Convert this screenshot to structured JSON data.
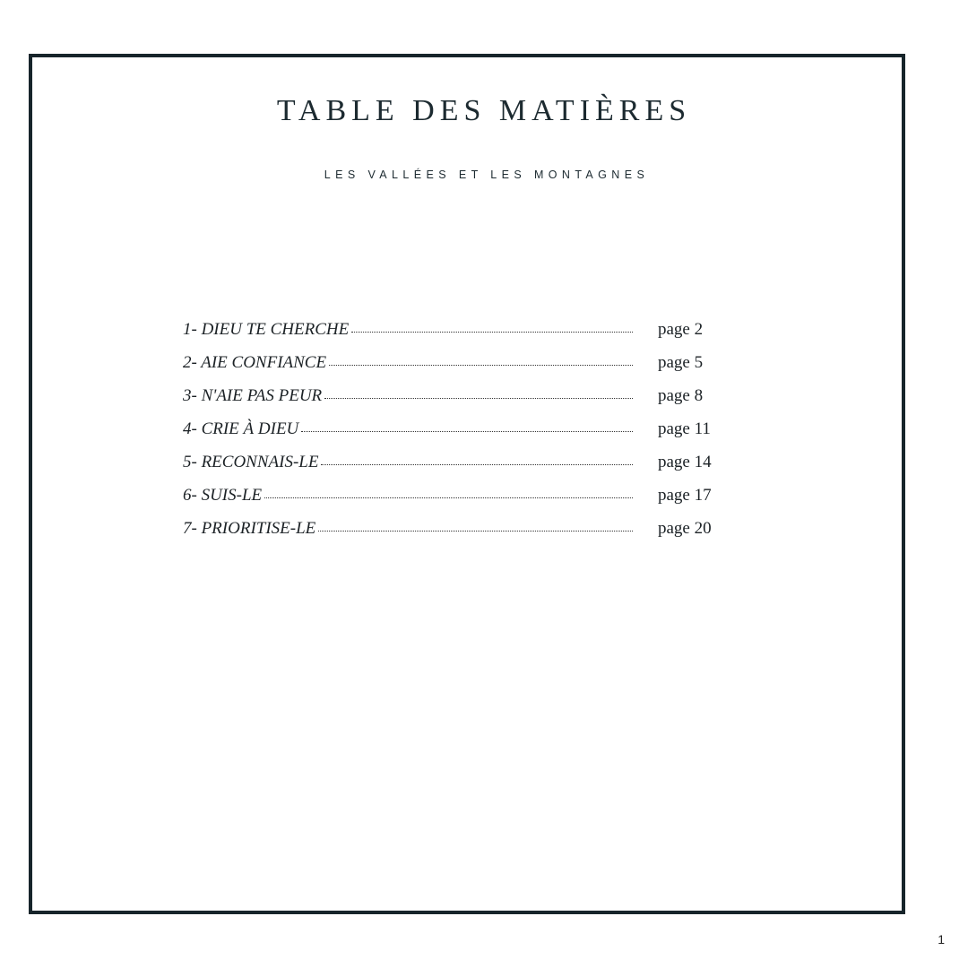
{
  "page": {
    "title": "TABLE DES MATIÈRES",
    "subtitle": "LES VALLÉES ET LES MONTAGNES",
    "page_number": "1",
    "colors": {
      "border": "#17252b",
      "text": "#1c2a30"
    }
  },
  "toc": [
    {
      "title": "1- DIEU TE CHERCHE",
      "page": "page 2"
    },
    {
      "title": "2- AIE CONFIANCE",
      "page": "page 5"
    },
    {
      "title": "3- N'AIE PAS PEUR",
      "page": "page 8"
    },
    {
      "title": "4- CRIE À DIEU",
      "page": "page 11"
    },
    {
      "title": "5- RECONNAIS-LE",
      "page": "page 14"
    },
    {
      "title": "6- SUIS-LE",
      "page": "page 17"
    },
    {
      "title": "7- PRIORITISE-LE",
      "page": "page 20"
    }
  ]
}
